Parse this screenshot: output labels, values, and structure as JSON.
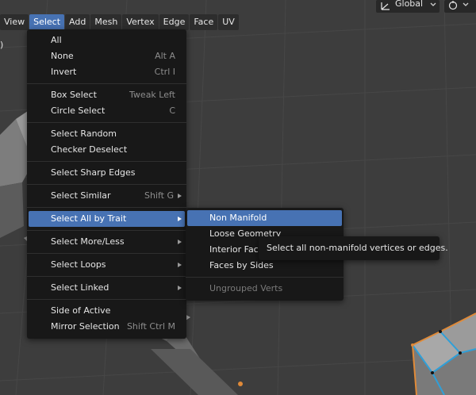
{
  "header": {
    "menus": [
      {
        "label": "View",
        "active": false
      },
      {
        "label": "Select",
        "active": true
      },
      {
        "label": "Add",
        "active": false
      },
      {
        "label": "Mesh",
        "active": false
      },
      {
        "label": "Vertex",
        "active": false
      },
      {
        "label": "Edge",
        "active": false
      },
      {
        "label": "Face",
        "active": false
      },
      {
        "label": "UV",
        "active": false
      }
    ],
    "transform_orientation": "Global",
    "transform_icon": "transform-orientation-icon",
    "pivot_icon": "snap-pivot-icon"
  },
  "side_text": ")",
  "select_menu": {
    "items": [
      {
        "label": "All",
        "shortcut": "",
        "submenu": false
      },
      {
        "label": "None",
        "shortcut": "Alt A",
        "submenu": false
      },
      {
        "label": "Invert",
        "shortcut": "Ctrl I",
        "submenu": false
      },
      {
        "label": "Box Select",
        "shortcut": "Tweak Left",
        "submenu": false
      },
      {
        "label": "Circle Select",
        "shortcut": "C",
        "submenu": false
      },
      {
        "label": "Select Random",
        "shortcut": "",
        "submenu": false
      },
      {
        "label": "Checker Deselect",
        "shortcut": "",
        "submenu": false
      },
      {
        "label": "Select Sharp Edges",
        "shortcut": "",
        "submenu": false
      },
      {
        "label": "Select Similar",
        "shortcut": "Shift G",
        "submenu": true
      },
      {
        "label": "Select All by Trait",
        "shortcut": "",
        "submenu": true,
        "highlighted": true
      },
      {
        "label": "Select More/Less",
        "shortcut": "",
        "submenu": true
      },
      {
        "label": "Select Loops",
        "shortcut": "",
        "submenu": true
      },
      {
        "label": "Select Linked",
        "shortcut": "",
        "submenu": true
      },
      {
        "label": "Side of Active",
        "shortcut": "",
        "submenu": false
      },
      {
        "label": "Mirror Selection",
        "shortcut": "Shift Ctrl M",
        "submenu": false
      }
    ]
  },
  "trait_menu": {
    "items": [
      {
        "label": "Non Manifold",
        "highlighted": true,
        "disabled": false
      },
      {
        "label": "Loose Geometry",
        "highlighted": false,
        "disabled": false
      },
      {
        "label": "Interior Faces",
        "highlighted": false,
        "disabled": false
      },
      {
        "label": "Faces by Sides",
        "highlighted": false,
        "disabled": false
      },
      {
        "label": "Ungrouped Verts",
        "highlighted": false,
        "disabled": true
      }
    ]
  },
  "tooltip": {
    "text": "Select all non-manifold vertices or edges."
  },
  "colors": {
    "accent": "#4772b3",
    "menu_bg": "#181818",
    "viewport_bg": "#3d3d3d",
    "selection_orange": "#e08a38",
    "edge_blue": "#2f9fd8"
  }
}
